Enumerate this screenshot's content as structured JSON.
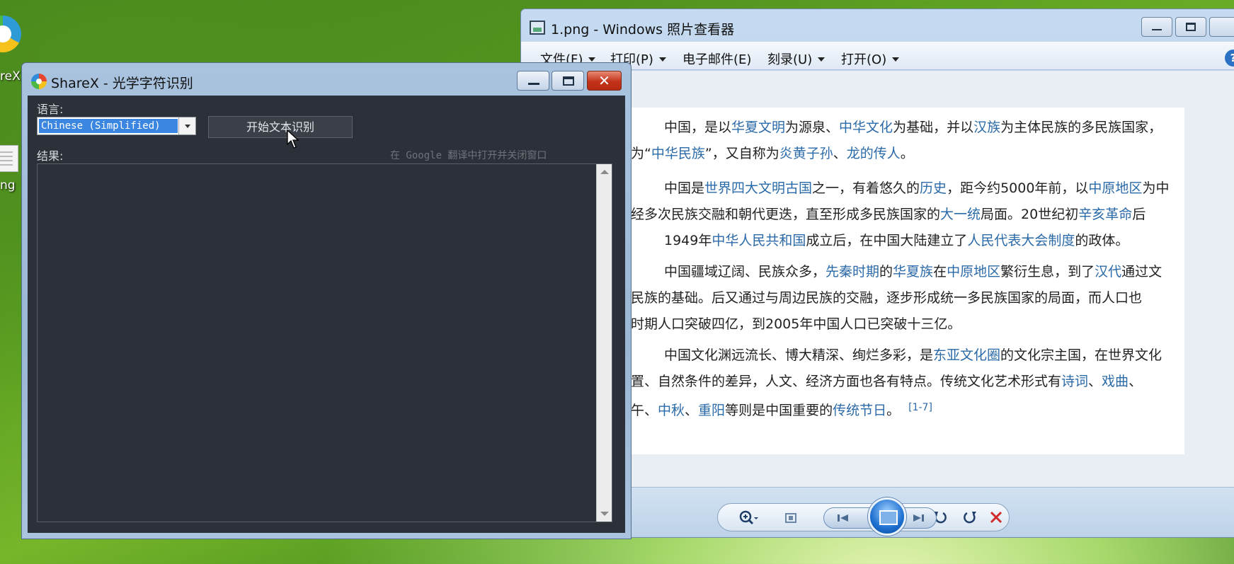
{
  "desktop": {
    "icon1_label": "reX",
    "icon2_label": "ng"
  },
  "viewer": {
    "title": "1.png - Windows 照片查看器",
    "menu": [
      {
        "label": "文件(F)",
        "has_arrow": true
      },
      {
        "label": "打印(P)",
        "has_arrow": true
      },
      {
        "label": "电子邮件(E)",
        "has_arrow": false
      },
      {
        "label": "刻录(U)",
        "has_arrow": true
      },
      {
        "label": "打开(O)",
        "has_arrow": true
      }
    ],
    "help": "?",
    "image_text": {
      "p1_l1_a": "中国，是以",
      "p1_l1_link1": "华夏文明",
      "p1_l1_b": "为源泉、",
      "p1_l1_link2": "中华文化",
      "p1_l1_c": "为基础，并以",
      "p1_l1_link3": "汉族",
      "p1_l1_d": "为主体民族的多民族国家，",
      "p1_l2_a": "为“",
      "p1_l2_link1": "中华民族",
      "p1_l2_b": "”，又自称为",
      "p1_l2_link2": "炎黄子孙",
      "p1_l2_c": "、",
      "p1_l2_link3": "龙的传人",
      "p1_l2_d": "。",
      "p2_l1_a": "中国是",
      "p2_l1_link1": "世界四大文明古国",
      "p2_l1_b": "之一，有着悠久的",
      "p2_l1_link2": "历史",
      "p2_l1_c": "，距今约5000年前，以",
      "p2_l1_link3": "中原地区",
      "p2_l1_d": "为中",
      "p2_l2_a": "经多次民族交融和朝代更迭，直至形成多民族国家的",
      "p2_l2_link1": "大一统",
      "p2_l2_b": "局面。20世纪初",
      "p2_l2_link2": "辛亥革命",
      "p2_l2_c": "后",
      "p2_l3_a": "1949年",
      "p2_l3_link1": "中华人民共和国",
      "p2_l3_b": "成立后，在中国大陆建立了",
      "p2_l3_link2": "人民代表大会制度",
      "p2_l3_c": "的政体。",
      "p3_l1_a": "中国疆域辽阔、民族众多，",
      "p3_l1_link1": "先秦时期",
      "p3_l1_b": "的",
      "p3_l1_link2": "华夏族",
      "p3_l1_c": "在",
      "p3_l1_link3": "中原地区",
      "p3_l1_d": "繁衍生息，到了",
      "p3_l1_link4": "汉代",
      "p3_l1_e": "通过文",
      "p3_l2": "民族的基础。后又通过与周边民族的交融，逐步形成统一多民族国家的局面，而人口也",
      "p3_l3": "时期人口突破四亿，到2005年中国人口已突破十三亿。",
      "p4_l1_a": "中国文化渊远流长、博大精深、绚烂多彩，是",
      "p4_l1_link1": "东亚文化圈",
      "p4_l1_b": "的文化宗主国，在世界文化",
      "p4_l2_a": "置、自然条件的差异，人文、经济方面也各有特点。传统文化艺术形式有",
      "p4_l2_link1": "诗词",
      "p4_l2_b": "、",
      "p4_l2_link2": "戏曲",
      "p4_l2_c": "、",
      "p4_l3_a": "午、",
      "p4_l3_link1": "中秋",
      "p4_l3_b": "、",
      "p4_l3_link2": "重阳",
      "p4_l3_c": "等则是中国重要的",
      "p4_l3_link3": "传统节日",
      "p4_l3_d": "。",
      "p4_ref": "[1-7]"
    }
  },
  "sharex": {
    "title": "ShareX - 光学字符识别",
    "close_glyph": "✕",
    "language_label": "语言:",
    "language_value": "Chinese (Simplified)",
    "start_button": "开始文本识别",
    "result_label": "结果:",
    "google_link": "在 Google 翻译中打开并关闭窗口",
    "result_text": ""
  }
}
